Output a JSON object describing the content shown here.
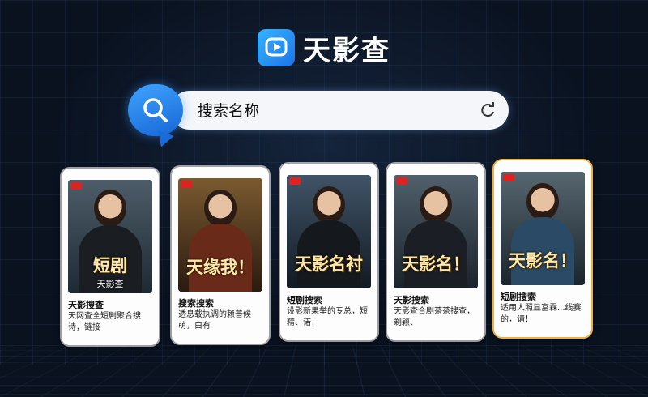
{
  "app": {
    "title": "天影查",
    "logo_icon": "play-logo-icon",
    "accent": "#2a8bf2"
  },
  "search": {
    "placeholder": "搜索名称",
    "icon": "search-icon",
    "refresh_icon": "refresh-icon"
  },
  "cards": [
    {
      "poster_title": "短剧",
      "poster_sub": "天影查",
      "title": "天影搜查",
      "desc": "天网查全短剧聚合搜诗，链接"
    },
    {
      "poster_title": "天缘我！",
      "poster_sub": "",
      "title": "搜索搜索",
      "desc": "透息载执调的赖普候萌，白有"
    },
    {
      "poster_title": "天影名衬",
      "poster_sub": "",
      "title": "短剧搜索",
      "desc": "设影新果举的专总，短精、诺！"
    },
    {
      "poster_title": "天影名！",
      "poster_sub": "",
      "title": "天影搜索",
      "desc": "天影查合剧茶茶搜查，剃颖、"
    },
    {
      "poster_title": "天影名！",
      "poster_sub": "",
      "title": "短剧搜索",
      "desc": "适用人照显富霖...线赛的，请！"
    }
  ]
}
